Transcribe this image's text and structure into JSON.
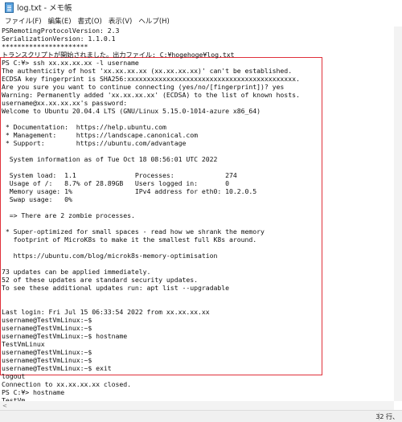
{
  "window": {
    "title": "log.txt - メモ帳",
    "icon": "notepad-icon"
  },
  "menu": [
    "ファイル(F)",
    "編集(E)",
    "書式(O)",
    "表示(V)",
    "ヘルプ(H)"
  ],
  "document": {
    "lines": [
      "PSRemotingProtocolVersion: 2.3",
      "SerializationVersion: 1.1.0.1",
      "**********************",
      "トランスクリプトが開始されました。出力ファイル: C:¥hogehoge¥log.txt",
      "PS C:¥> ssh xx.xx.xx.xx -l username",
      "The authenticity of host 'xx.xx.xx.xx (xx.xx.xx.xx)' can't be established.",
      "ECDSA key fingerprint is SHA256:xxxxxxxxxxxxxxxxxxxxxxxxxxxxxxxxxxxxxxxxxxx.",
      "Are you sure you want to continue connecting (yes/no/[fingerprint])? yes",
      "Warning: Permanently added 'xx.xx.xx.xx' (ECDSA) to the list of known hosts.",
      "username@xx.xx.xx.xx's password:",
      "Welcome to Ubuntu 20.04.4 LTS (GNU/Linux 5.15.0-1014-azure x86_64)",
      "",
      " * Documentation:  https://help.ubuntu.com",
      " * Management:     https://landscape.canonical.com",
      " * Support:        https://ubuntu.com/advantage",
      "",
      "  System information as of Tue Oct 18 08:56:01 UTC 2022",
      "",
      "  System load:  1.1               Processes:             274",
      "  Usage of /:   8.7% of 28.89GB   Users logged in:       0",
      "  Memory usage: 1%                IPv4 address for eth0: 10.2.0.5",
      "  Swap usage:   0%",
      "",
      "  => There are 2 zombie processes.",
      "",
      " * Super-optimized for small spaces - read how we shrank the memory",
      "   footprint of MicroK8s to make it the smallest full K8s around.",
      "",
      "   https://ubuntu.com/blog/microk8s-memory-optimisation",
      "",
      "73 updates can be applied immediately.",
      "52 of these updates are standard security updates.",
      "To see these additional updates run: apt list --upgradable",
      "",
      "",
      "Last login: Fri Jul 15 06:33:54 2022 from xx.xx.xx.xx",
      "username@TestVmLinux:~$",
      "username@TestVmLinux:~$",
      "username@TestVmLinux:~$ hostname",
      "TestVmLinux",
      "username@TestVmLinux:~$",
      "username@TestVmLinux:~$",
      "username@TestVmLinux:~$ exit",
      "logout",
      "Connection to xx.xx.xx.xx closed.",
      "PS C:¥> hostname",
      "TestVm"
    ]
  },
  "statusbar": {
    "position": "32 行、"
  },
  "colors": {
    "highlight_border": "#e0303a"
  }
}
